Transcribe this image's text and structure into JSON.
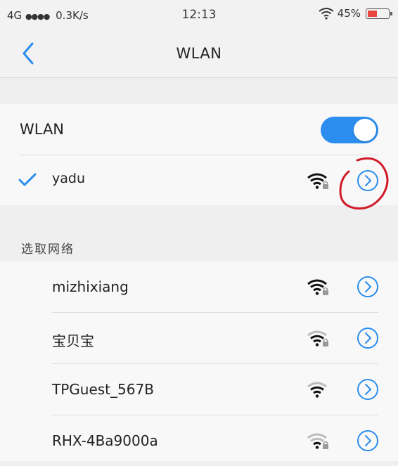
{
  "status_bar": {
    "network": "4G",
    "signal_dots": "●●●●",
    "speed": "0.3K/s",
    "time": "12:13",
    "battery": "45%",
    "battery_level": 0.45,
    "battery_color": "#e8473f"
  },
  "nav": {
    "back_icon": "chevron-left-icon",
    "title": "WLAN"
  },
  "wlan_toggle": {
    "label": "WLAN",
    "on": true,
    "color": "#2b8ded"
  },
  "connected": {
    "name": "yadu",
    "checked": true,
    "secured": true
  },
  "section_header": "选取网络",
  "networks": [
    {
      "name": "mizhixiang",
      "secured": true,
      "signal": "strong"
    },
    {
      "name": "宝贝宝",
      "secured": true,
      "signal": "medium"
    },
    {
      "name": "TPGuest_567B",
      "secured": false,
      "signal": "medium"
    },
    {
      "name": "RHX-4Ba9000a",
      "secured": true,
      "signal": "weak"
    }
  ],
  "colors": {
    "accent": "#2b8ded",
    "annotation": "#d11a2a"
  }
}
